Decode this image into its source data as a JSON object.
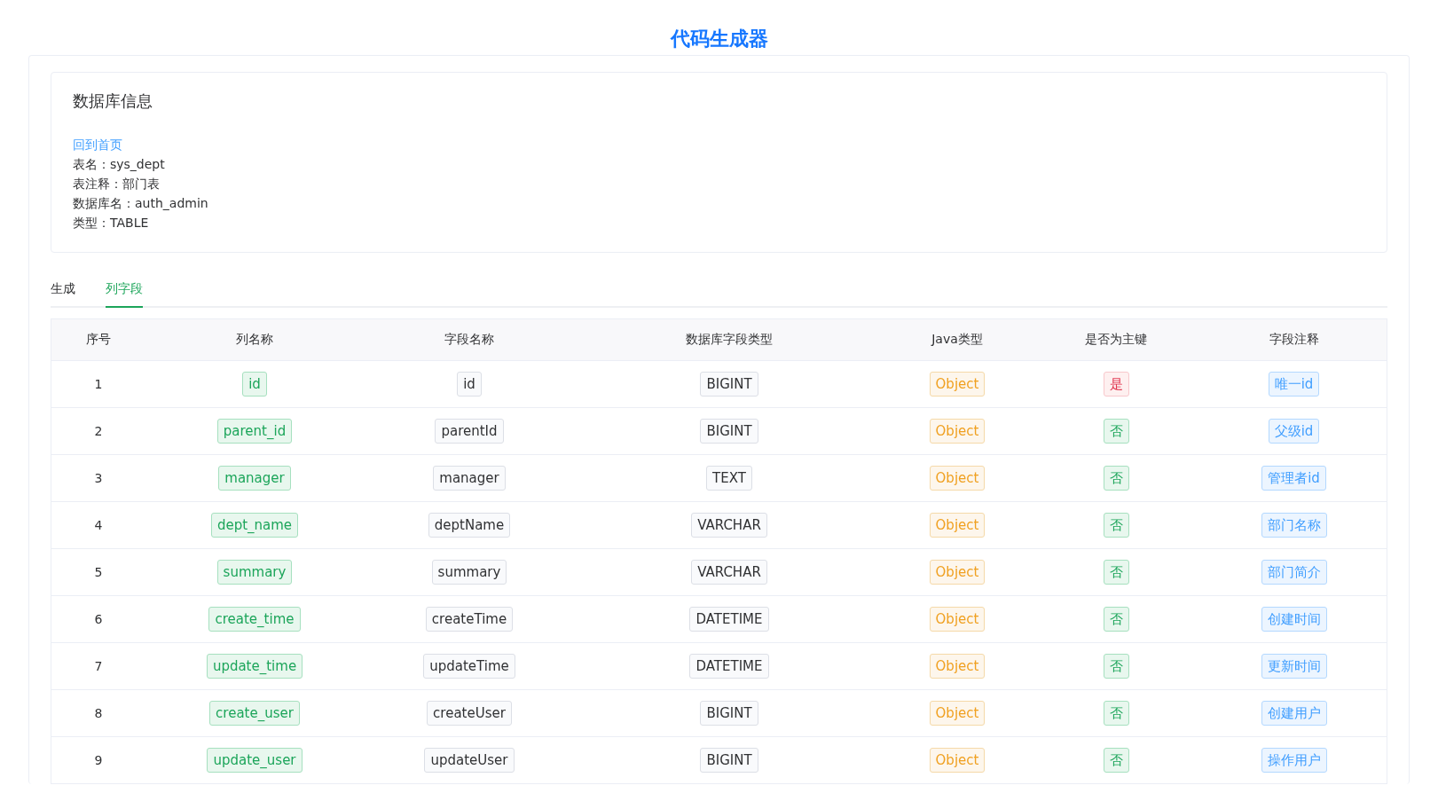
{
  "title": "代码生成器",
  "info": {
    "heading": "数据库信息",
    "back_link": "回到首页",
    "lines": [
      "表名：sys_dept",
      "表注释：部门表",
      "数据库名：auth_admin",
      "类型：TABLE"
    ]
  },
  "tabs": [
    {
      "label": "生成",
      "selected": false
    },
    {
      "label": "列字段",
      "selected": true
    }
  ],
  "table": {
    "columns": [
      "序号",
      "列名称",
      "字段名称",
      "数据库字段类型",
      "Java类型",
      "是否为主键",
      "字段注释"
    ],
    "rows": [
      {
        "index": "1",
        "column_name": "id",
        "field_name": "id",
        "db_type": "BIGINT",
        "java_type": "Object",
        "primary_key": "是",
        "is_primary": true,
        "comment": "唯一id"
      },
      {
        "index": "2",
        "column_name": "parent_id",
        "field_name": "parentId",
        "db_type": "BIGINT",
        "java_type": "Object",
        "primary_key": "否",
        "is_primary": false,
        "comment": "父级id"
      },
      {
        "index": "3",
        "column_name": "manager",
        "field_name": "manager",
        "db_type": "TEXT",
        "java_type": "Object",
        "primary_key": "否",
        "is_primary": false,
        "comment": "管理者id"
      },
      {
        "index": "4",
        "column_name": "dept_name",
        "field_name": "deptName",
        "db_type": "VARCHAR",
        "java_type": "Object",
        "primary_key": "否",
        "is_primary": false,
        "comment": "部门名称"
      },
      {
        "index": "5",
        "column_name": "summary",
        "field_name": "summary",
        "db_type": "VARCHAR",
        "java_type": "Object",
        "primary_key": "否",
        "is_primary": false,
        "comment": "部门简介"
      },
      {
        "index": "6",
        "column_name": "create_time",
        "field_name": "createTime",
        "db_type": "DATETIME",
        "java_type": "Object",
        "primary_key": "否",
        "is_primary": false,
        "comment": "创建时间"
      },
      {
        "index": "7",
        "column_name": "update_time",
        "field_name": "updateTime",
        "db_type": "DATETIME",
        "java_type": "Object",
        "primary_key": "否",
        "is_primary": false,
        "comment": "更新时间"
      },
      {
        "index": "8",
        "column_name": "create_user",
        "field_name": "createUser",
        "db_type": "BIGINT",
        "java_type": "Object",
        "primary_key": "否",
        "is_primary": false,
        "comment": "创建用户"
      },
      {
        "index": "9",
        "column_name": "update_user",
        "field_name": "updateUser",
        "db_type": "BIGINT",
        "java_type": "Object",
        "primary_key": "否",
        "is_primary": false,
        "comment": "操作用户"
      }
    ]
  }
}
